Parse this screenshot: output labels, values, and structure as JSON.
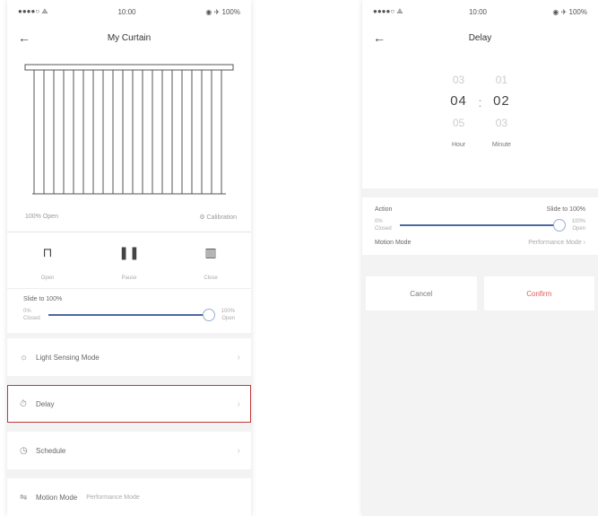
{
  "left": {
    "status": {
      "left": "●●●●○ ⟁",
      "time": "10:00",
      "right": "◉ ✈ 100%"
    },
    "nav": {
      "back": "←",
      "title": "My Curtain"
    },
    "curtain_meta": {
      "left": "100% Open",
      "right": "⚙ Calibration"
    },
    "controls": [
      {
        "icon": "⊓",
        "label": "Open"
      },
      {
        "icon": "❚❚",
        "label": "Pause"
      },
      {
        "icon": "▥",
        "label": "Close"
      }
    ],
    "slider": {
      "head": "Slide to 100%",
      "min_label": "0%\nClosed",
      "max_label": "100%\nOpen",
      "value": 1.0
    },
    "menu": [
      {
        "icon": "☼",
        "label": "Light Sensing Mode",
        "extra": "",
        "selected": false
      },
      {
        "icon": "⏱",
        "label": "Delay",
        "extra": "",
        "selected": true
      },
      {
        "icon": "◷",
        "label": "Schedule",
        "extra": "",
        "selected": false
      },
      {
        "icon": "⇋",
        "label": "Motion Mode",
        "extra": "Performance Mode",
        "selected": false
      }
    ]
  },
  "right": {
    "status": {
      "left": "●●●●○ ⟁",
      "time": "10:00",
      "right": "◉ ✈ 100%"
    },
    "nav": {
      "back": "←",
      "title": "Delay"
    },
    "picker": {
      "hours": {
        "above": "03",
        "value": "04",
        "below": "05",
        "unit": "Hour"
      },
      "minutes": {
        "above": "01",
        "value": "02",
        "below": "03",
        "unit": "Minute"
      },
      "separator": ":"
    },
    "settings": {
      "action_label": "Action",
      "action_value": "Slide to 100%",
      "min_label": "0%\nClosed",
      "max_label": "100%\nOpen",
      "value": 1.0,
      "mode_label": "Motion Mode",
      "mode_value": "Performance Mode ›"
    },
    "buttons": {
      "cancel": "Cancel",
      "confirm": "Confirm"
    }
  }
}
